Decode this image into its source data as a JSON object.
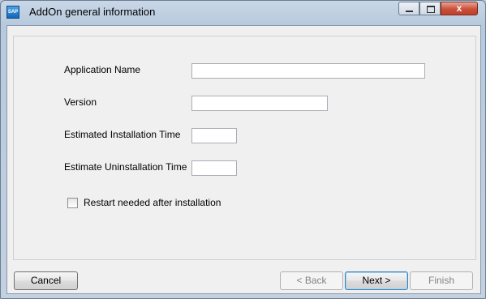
{
  "window": {
    "title": "AddOn general information",
    "icon": "sap-icon",
    "icon_text": "SAP",
    "controls": {
      "minimize": "minimize-icon",
      "maximize": "maximize-icon",
      "close_glyph": "x"
    }
  },
  "form": {
    "application_name": {
      "label": "Application Name",
      "value": ""
    },
    "version": {
      "label": "Version",
      "value": ""
    },
    "install_time": {
      "label": "Estimated Installation Time",
      "value": ""
    },
    "uninstall_time": {
      "label": "Estimate Uninstallation Time",
      "value": ""
    },
    "restart": {
      "label": "Restart needed after installation",
      "checked": false
    }
  },
  "buttons": {
    "cancel": "Cancel",
    "back": "< Back",
    "next": "Next >",
    "finish": "Finish"
  }
}
